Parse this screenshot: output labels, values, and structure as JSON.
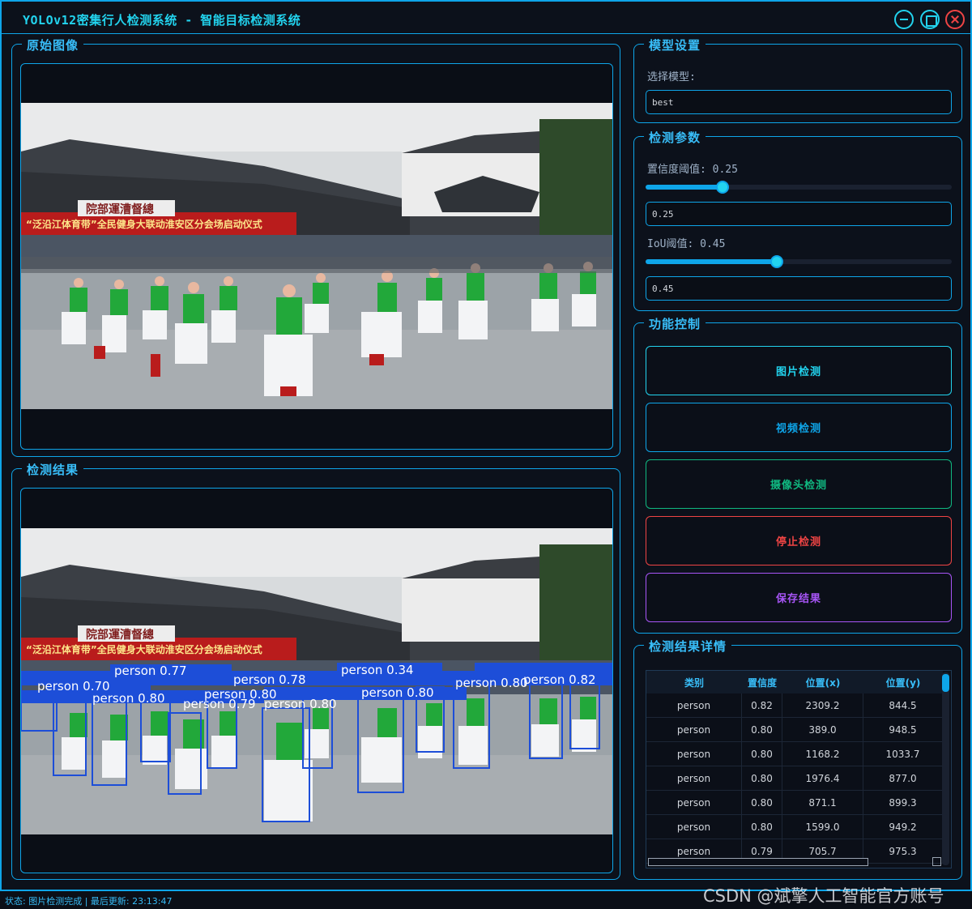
{
  "window": {
    "title": "YOLOv12密集行人检测系统 - 智能目标检测系统"
  },
  "panels": {
    "original_title": "原始图像",
    "result_title": "检测结果",
    "model_title": "模型设置",
    "params_title": "检测参数",
    "control_title": "功能控制",
    "details_title": "检测结果详情"
  },
  "image_banner": {
    "sign1": "院部運漕督總",
    "sign2": "“泛沿江体育带”全民健身大联动淮安区分会场启动仪式"
  },
  "model": {
    "select_label": "选择模型:",
    "selected": "best"
  },
  "params": {
    "conf_label": "置信度阈值: 0.25",
    "conf_value": "0.25",
    "conf_level": 0.25,
    "iou_label": "IoU阈值: 0.45",
    "iou_value": "0.45",
    "iou_level": 0.45
  },
  "buttons": [
    {
      "label": "图片检测",
      "color": "#22d3ee"
    },
    {
      "label": "视频检测",
      "color": "#0ea5e9"
    },
    {
      "label": "摄像头检测",
      "color": "#10b981"
    },
    {
      "label": "停止检测",
      "color": "#ef4444"
    },
    {
      "label": "保存结果",
      "color": "#a855f7"
    }
  ],
  "detections": {
    "columns": [
      "类别",
      "置信度",
      "位置(x)",
      "位置(y)"
    ],
    "rows": [
      [
        "person",
        "0.82",
        "2309.2",
        "844.5"
      ],
      [
        "person",
        "0.80",
        "389.0",
        "948.5"
      ],
      [
        "person",
        "0.80",
        "1168.2",
        "1033.7"
      ],
      [
        "person",
        "0.80",
        "1976.4",
        "877.0"
      ],
      [
        "person",
        "0.80",
        "871.1",
        "899.3"
      ],
      [
        "person",
        "0.80",
        "1599.0",
        "949.2"
      ],
      [
        "person",
        "0.79",
        "705.7",
        "975.3"
      ]
    ]
  },
  "overlay_labels": [
    "person 0.77",
    "person 0.78",
    "person 0.34",
    "person 0.82",
    "person 0.80",
    "person 0.80",
    "person 0.80",
    "person 0.79",
    "person 0.80",
    "person 0.80",
    "person 0.70"
  ],
  "status": {
    "text": "状态: 图片检测完成 | 最后更新: 23:13:47"
  },
  "watermark": "CSDN @斌擎人工智能官方账号"
}
